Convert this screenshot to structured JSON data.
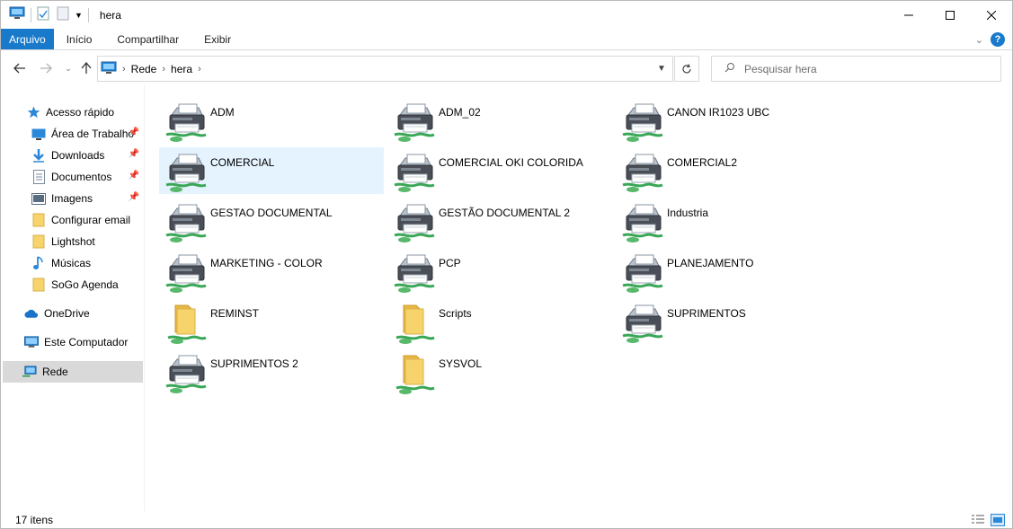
{
  "window": {
    "title": "hera"
  },
  "ribbon": {
    "tabs": [
      "Arquivo",
      "Início",
      "Compartilhar",
      "Exibir"
    ]
  },
  "address": {
    "crumbs": [
      "Rede",
      "hera"
    ]
  },
  "search": {
    "placeholder": "Pesquisar hera"
  },
  "nav": {
    "quick_access": "Acesso rápido",
    "items": [
      {
        "label": "Área de Trabalho",
        "icon": "desktop-icon",
        "pinned": true
      },
      {
        "label": "Downloads",
        "icon": "download-icon",
        "pinned": true
      },
      {
        "label": "Documentos",
        "icon": "document-icon",
        "pinned": true
      },
      {
        "label": "Imagens",
        "icon": "image-icon",
        "pinned": true
      },
      {
        "label": "Configurar email",
        "icon": "folder-icon",
        "pinned": false
      },
      {
        "label": "Lightshot",
        "icon": "folder-icon",
        "pinned": false
      },
      {
        "label": "Músicas",
        "icon": "music-icon",
        "pinned": false
      },
      {
        "label": "SoGo Agenda",
        "icon": "folder-icon",
        "pinned": false
      }
    ],
    "onedrive": "OneDrive",
    "this_pc": "Este Computador",
    "network": "Rede"
  },
  "items": [
    {
      "name": "ADM",
      "type": "printer"
    },
    {
      "name": "ADM_02",
      "type": "printer"
    },
    {
      "name": "CANON IR1023 UBC",
      "type": "printer"
    },
    {
      "name": "COMERCIAL",
      "type": "printer",
      "selected": true
    },
    {
      "name": "COMERCIAL OKI COLORIDA",
      "type": "printer"
    },
    {
      "name": "COMERCIAL2",
      "type": "printer"
    },
    {
      "name": "GESTAO DOCUMENTAL",
      "type": "printer"
    },
    {
      "name": "GESTÃO DOCUMENTAL 2",
      "type": "printer"
    },
    {
      "name": "Industria",
      "type": "printer"
    },
    {
      "name": "MARKETING - COLOR",
      "type": "printer"
    },
    {
      "name": "PCP",
      "type": "printer"
    },
    {
      "name": "PLANEJAMENTO",
      "type": "printer"
    },
    {
      "name": "REMINST",
      "type": "share"
    },
    {
      "name": "Scripts",
      "type": "share"
    },
    {
      "name": "SUPRIMENTOS",
      "type": "printer"
    },
    {
      "name": "SUPRIMENTOS 2",
      "type": "printer"
    },
    {
      "name": "SYSVOL",
      "type": "share"
    }
  ],
  "status": {
    "count": "17 itens"
  },
  "colors": {
    "accent": "#1979ca",
    "selection": "#e5f3ff",
    "nav_selection": "#d9d9d9"
  }
}
